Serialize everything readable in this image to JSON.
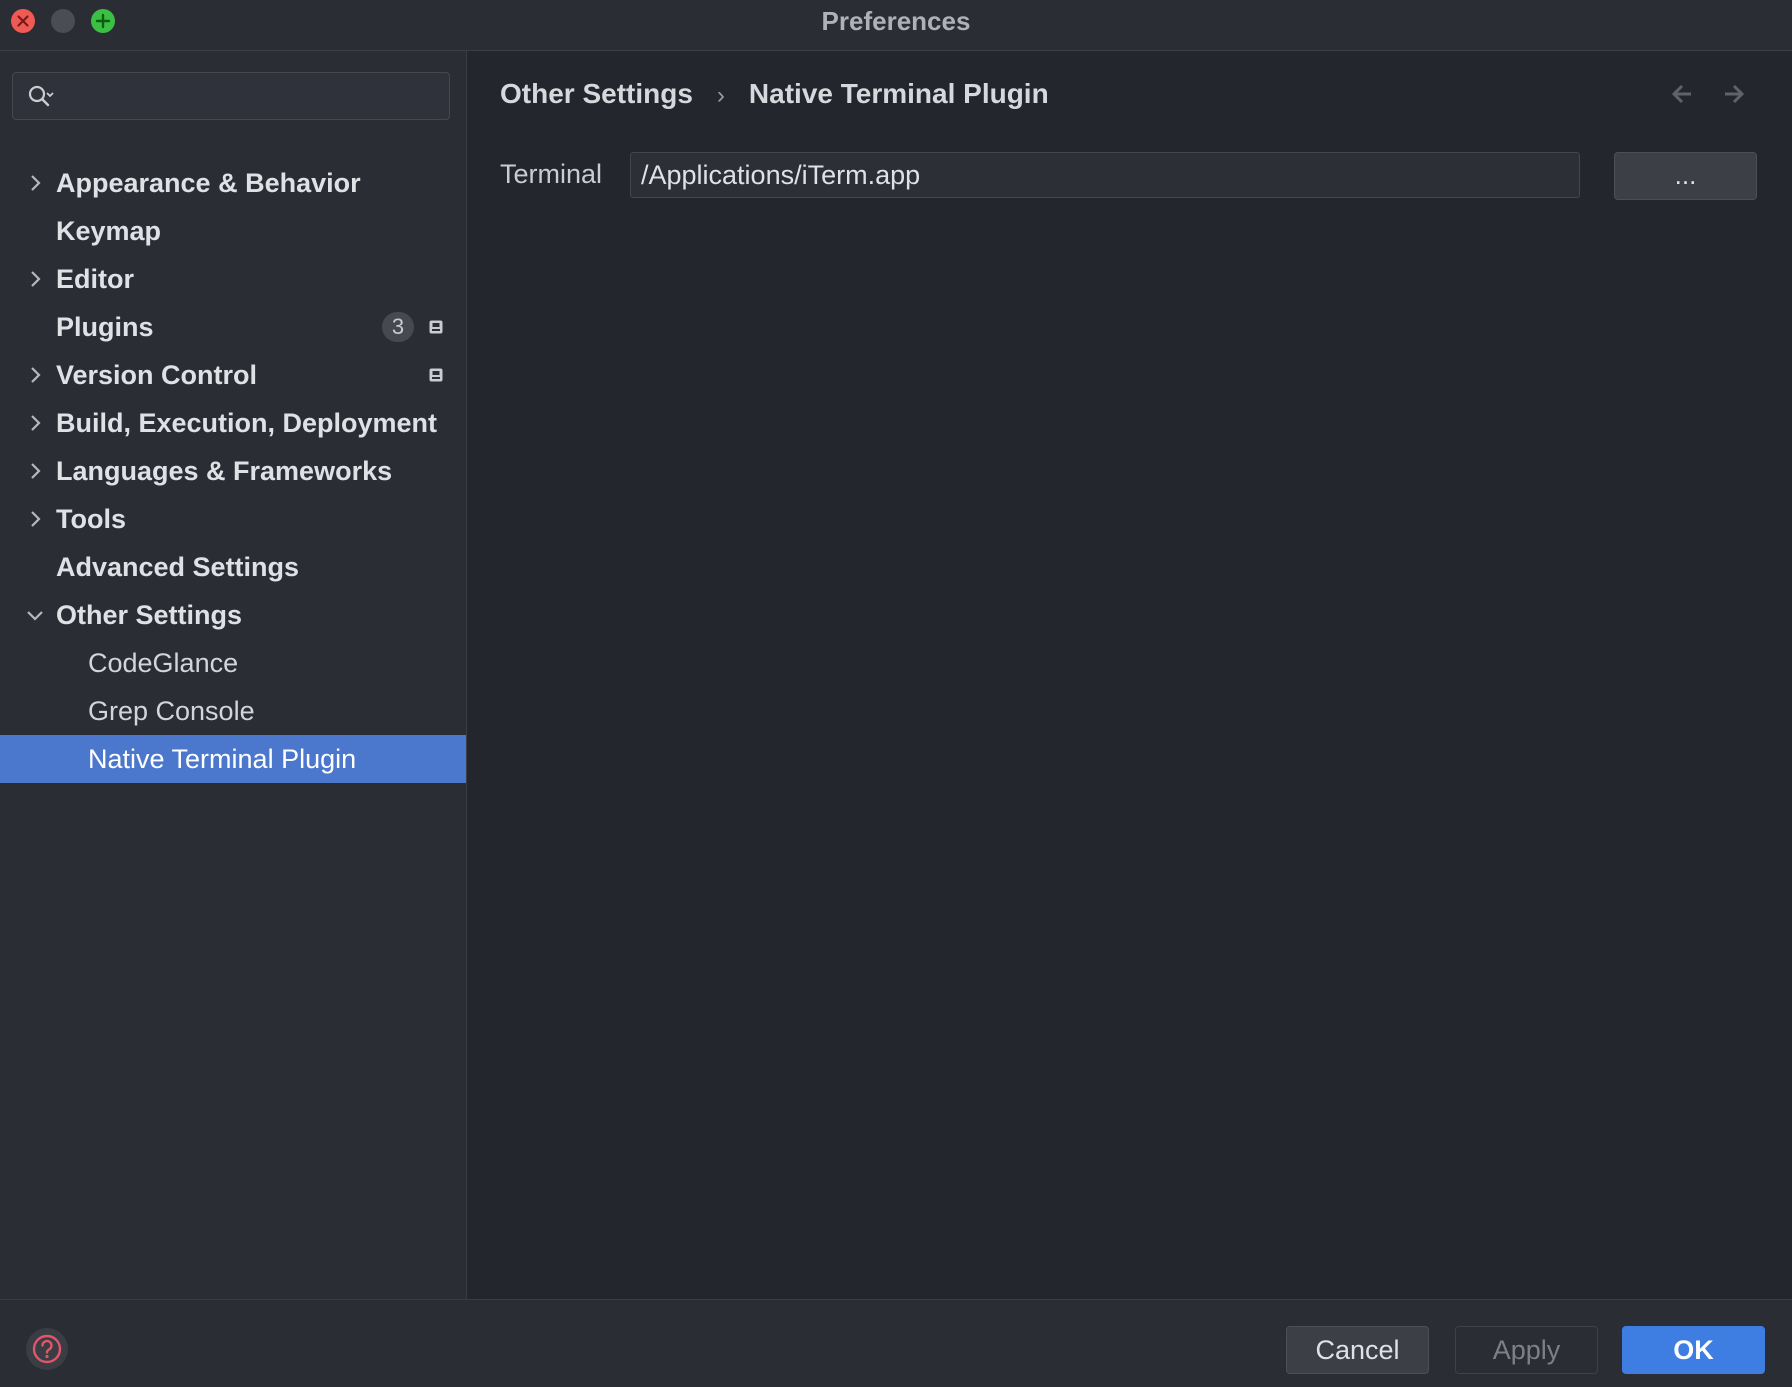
{
  "window": {
    "title": "Preferences"
  },
  "search": {
    "value": "",
    "placeholder": ""
  },
  "sidebar": {
    "items": [
      {
        "label": "Appearance & Behavior"
      },
      {
        "label": "Keymap"
      },
      {
        "label": "Editor"
      },
      {
        "label": "Plugins",
        "badge": "3"
      },
      {
        "label": "Version Control"
      },
      {
        "label": "Build, Execution, Deployment"
      },
      {
        "label": "Languages & Frameworks"
      },
      {
        "label": "Tools"
      },
      {
        "label": "Advanced Settings"
      },
      {
        "label": "Other Settings"
      },
      {
        "label": "CodeGlance"
      },
      {
        "label": "Grep Console"
      },
      {
        "label": "Native Terminal Plugin"
      }
    ]
  },
  "breadcrumb": {
    "parent": "Other Settings",
    "separator": "›",
    "current": "Native Terminal Plugin"
  },
  "form": {
    "terminal_label": "Terminal",
    "terminal_value": "/Applications/iTerm.app",
    "browse_label": "..."
  },
  "footer": {
    "cancel_label": "Cancel",
    "apply_label": "Apply",
    "ok_label": "OK"
  },
  "colors": {
    "accent": "#4b78cc",
    "ok_button": "#3e7ee3",
    "close": "#ef5b54",
    "maximize": "#3cc044"
  },
  "icons": {
    "search": "search-icon",
    "chevron_right": "chevron-right-icon",
    "chevron_down": "chevron-down-icon",
    "project": "project-level-icon",
    "back": "back-arrow-icon",
    "forward": "forward-arrow-icon",
    "help": "help-icon"
  }
}
